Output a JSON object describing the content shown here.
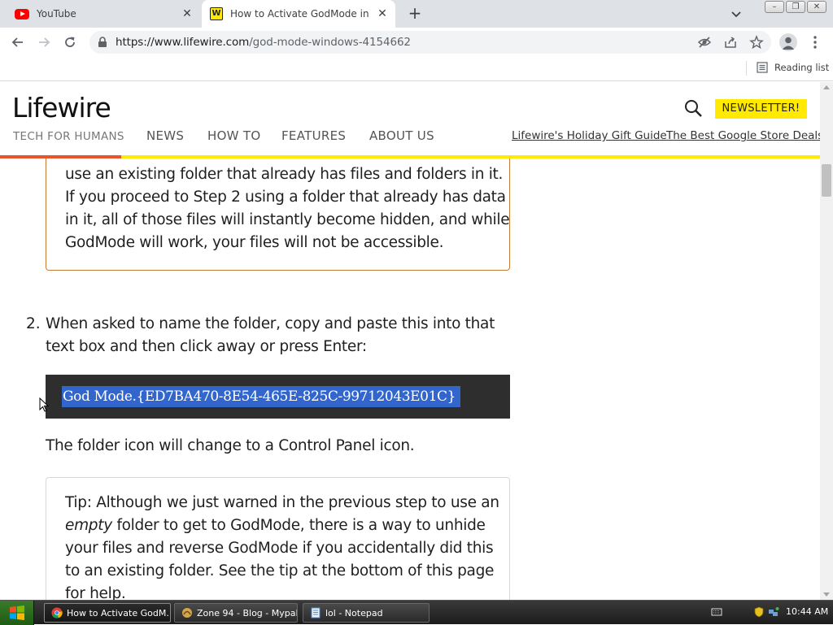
{
  "browser": {
    "tabs": [
      {
        "title": "YouTube",
        "icon": "youtube-icon",
        "active": false
      },
      {
        "title": "How to Activate GodMode in Windows",
        "icon": "lifewire-favicon",
        "active": true
      }
    ],
    "url_domain": "https://www.lifewire.com",
    "url_path": "/god-mode-windows-4154662",
    "reading_list_label": "Reading list"
  },
  "site": {
    "logo_text": "Lifewire",
    "tagline": "TECH FOR HUMANS",
    "nav": [
      "NEWS",
      "HOW TO",
      "FEATURES",
      "ABOUT US"
    ],
    "newsletter_label": "NEWSLETTER!",
    "promos": [
      "Lifewire's Holiday Gift Guide",
      "The Best Google Store Deals"
    ],
    "accent_color": "#ffea00",
    "progress_color": "#e8542b"
  },
  "article": {
    "note_lines": [
      "use an existing folder that already has files and folders in it.",
      "If you proceed to Step 2 using a folder that already has data",
      "in it, all of those files will instantly become hidden, and while",
      "GodMode will work, your files will not be accessible."
    ],
    "step_number": "2.",
    "step_text": "When asked to name the folder, copy and paste this into that text box and then click away or press Enter:",
    "code": "God Mode.{ED7BA470-8E54-465E-825C-99712043E01C}",
    "after_code": "The folder icon will change to a Control Panel icon.",
    "tip_lines": [
      {
        "pre": "Tip: Although we just warned in the previous step to use an",
        "em": "",
        "post": ""
      },
      {
        "pre": "",
        "em": "empty",
        "post": " folder to get to GodMode, there is a way to unhide"
      },
      {
        "pre": "your files and reverse GodMode if you accidentally did this",
        "em": "",
        "post": ""
      },
      {
        "pre": "to an existing folder. See the tip at the bottom of this page",
        "em": "",
        "post": ""
      },
      {
        "pre": "for help.",
        "em": "",
        "post": ""
      }
    ]
  },
  "taskbar": {
    "tasks": [
      {
        "label": "How to Activate GodM...",
        "icon": "chrome-icon",
        "active": true
      },
      {
        "label": "Zone 94 - Blog - Mypal",
        "icon": "mypal-icon",
        "active": false
      },
      {
        "label": "lol - Notepad",
        "icon": "notepad-icon",
        "active": false
      }
    ],
    "clock": "10:44 AM"
  }
}
